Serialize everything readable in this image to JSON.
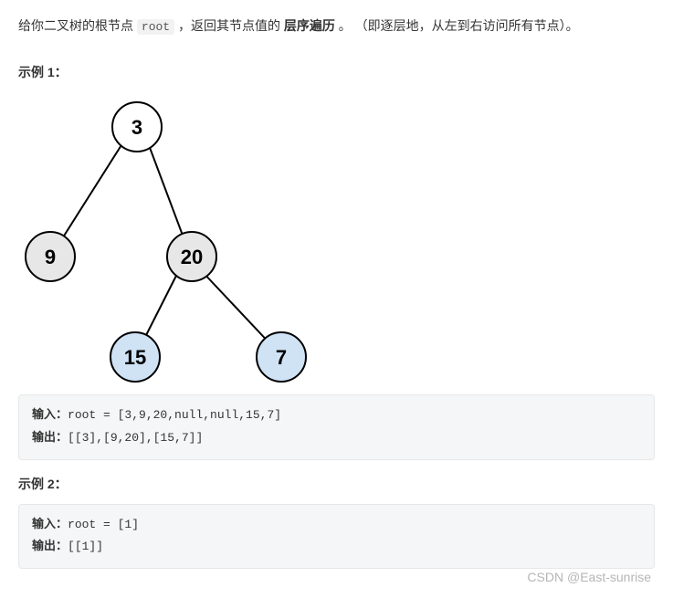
{
  "intro": {
    "pre": "给你二叉树的根节点 ",
    "code": "root",
    "mid1": " ，返回其节点值的 ",
    "bold": "层序遍历",
    "mid2": " 。  （即逐层地，从左到右访问所有节点）。"
  },
  "example1": {
    "heading": "示例 1：",
    "input_label": "输入：",
    "input_value": "root = [3,9,20,null,null,15,7]",
    "output_label": "输出：",
    "output_value": "[[3],[9,20],[15,7]]"
  },
  "example2": {
    "heading": "示例 2：",
    "input_label": "输入：",
    "input_value": "root = [1]",
    "output_label": "输出：",
    "output_value": "[[1]]"
  },
  "tree": {
    "nodes": {
      "root": "3",
      "left": "9",
      "right": "20",
      "rl": "15",
      "rr": "7"
    }
  },
  "watermark": "CSDN @East-sunrise"
}
